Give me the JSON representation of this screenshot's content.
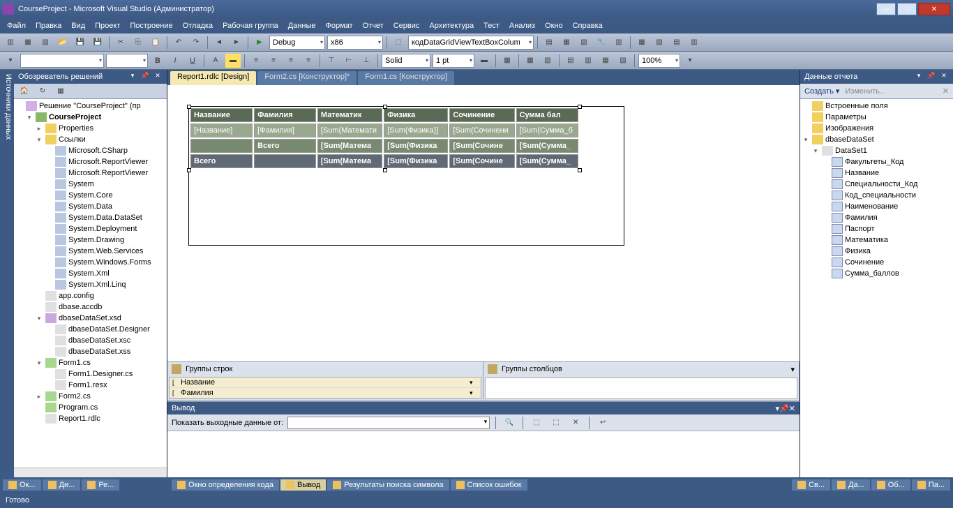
{
  "window": {
    "title": "CourseProject - Microsoft Visual Studio (Администратор)"
  },
  "menu": [
    "Файл",
    "Правка",
    "Вид",
    "Проект",
    "Построение",
    "Отладка",
    "Рабочая группа",
    "Данные",
    "Формат",
    "Отчет",
    "Сервис",
    "Архитектура",
    "Тест",
    "Анализ",
    "Окно",
    "Справка"
  ],
  "toolbar": {
    "config": "Debug",
    "platform": "x86",
    "find": "кодDataGridViewTextBoxColum",
    "border_style": "Solid",
    "border_width": "1 pt",
    "zoom": "100%"
  },
  "doctabs": [
    {
      "label": "Report1.rdlc [Design]",
      "active": true
    },
    {
      "label": "Form2.cs [Конструктор]*",
      "active": false
    },
    {
      "label": "Form1.cs [Конструктор]",
      "active": false
    }
  ],
  "solution_explorer": {
    "title": "Обозреватель решений",
    "solution": "Решение \"CourseProject\" (пр",
    "project": "CourseProject",
    "nodes": {
      "properties": "Properties",
      "refs": "Ссылки",
      "ref_items": [
        "Microsoft.CSharp",
        "Microsoft.ReportViewer",
        "Microsoft.ReportViewer",
        "System",
        "System.Core",
        "System.Data",
        "System.Data.DataSet",
        "System.Deployment",
        "System.Drawing",
        "System.Web.Services",
        "System.Windows.Forms",
        "System.Xml",
        "System.Xml.Linq"
      ],
      "files": [
        "app.config",
        "dbase.accdb"
      ],
      "dataset": "dbaseDataSet.xsd",
      "dataset_items": [
        "dbaseDataSet.Designer",
        "dbaseDataSet.xsc",
        "dbaseDataSet.xss"
      ],
      "form1": "Form1.cs",
      "form1_items": [
        "Form1.Designer.cs",
        "Form1.resx"
      ],
      "form2": "Form2.cs",
      "program": "Program.cs",
      "report": "Report1.rdlc"
    }
  },
  "sidestrip": "Источники данных",
  "report": {
    "headers": [
      "Название",
      "Фамилия",
      "Математик",
      "Физика",
      "Сочинение",
      "Сумма бал"
    ],
    "data": [
      "[Название]",
      "[Фамилия]",
      "[Sum(Математи",
      "[Sum(Физика)]",
      "[Sum(Сочинени",
      "[Sum(Сумма_б"
    ],
    "sub1": [
      "",
      "Всего",
      "[Sum(Матема",
      "[Sum(Физика",
      "[Sum(Сочине",
      "[Sum(Сумма_"
    ],
    "sub2": [
      "Всего",
      "",
      "[Sum(Матема",
      "[Sum(Физика",
      "[Sum(Сочине",
      "[Sum(Сумма_"
    ]
  },
  "groups": {
    "rows_title": "Группы строк",
    "cols_title": "Группы столбцов",
    "row_groups": [
      "Название",
      "Фамилия"
    ]
  },
  "output": {
    "title": "Вывод",
    "show_label": "Показать выходные данные от:"
  },
  "report_data": {
    "title": "Данные отчета",
    "create": "Создать",
    "edit": "Изменить...",
    "nodes": {
      "builtin": "Встроенные поля",
      "params": "Параметры",
      "images": "Изображения",
      "ds": "dbaseDataSet",
      "dataset1": "DataSet1",
      "fields": [
        "Факультеты_Код",
        "Название",
        "Специальности_Код",
        "Код_специальности",
        "Наименование",
        "Фамилия",
        "Паспорт",
        "Математика",
        "Физика",
        "Сочинение",
        "Сумма_баллов"
      ]
    }
  },
  "bottom_tabs_left": [
    "Ок...",
    "Ди...",
    "Ре..."
  ],
  "bottom_tabs_center": [
    {
      "label": "Окно определения кода",
      "active": false
    },
    {
      "label": "Вывод",
      "active": true
    },
    {
      "label": "Результаты поиска символа",
      "active": false
    },
    {
      "label": "Список ошибок",
      "active": false
    }
  ],
  "bottom_tabs_right": [
    "Св...",
    "Да...",
    "Об...",
    "Па..."
  ],
  "status": "Готово"
}
